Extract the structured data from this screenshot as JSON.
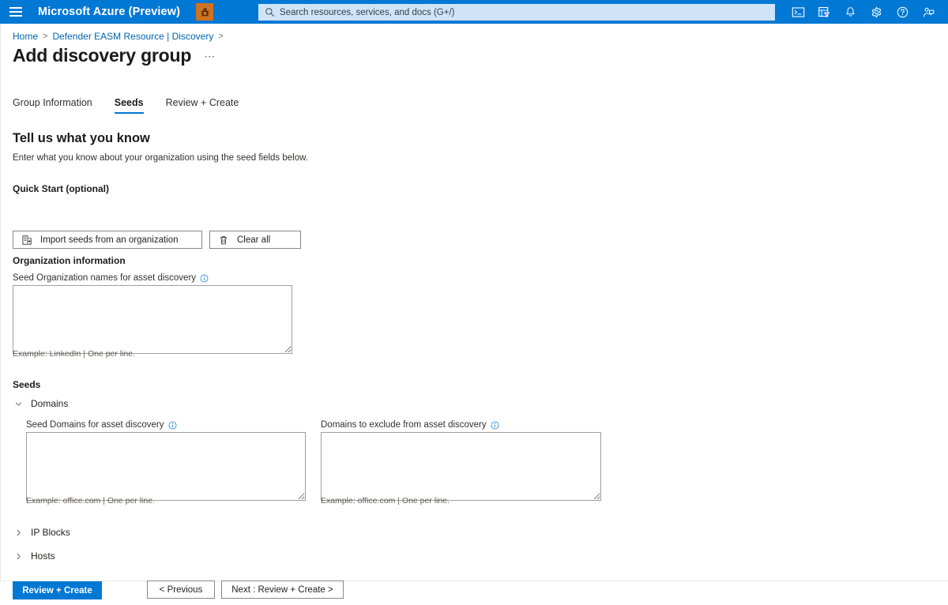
{
  "topbar": {
    "menu_icon": "hamburger-icon",
    "brand": "Microsoft Azure (Preview)",
    "preview_badge_icon": "preview-bug-icon",
    "search": {
      "icon": "search-icon",
      "placeholder": "Search resources, services, and docs (G+/)",
      "value": ""
    },
    "icons": [
      {
        "name": "cloud-shell-icon",
        "title": "Cloud Shell"
      },
      {
        "name": "directory-filter-icon",
        "title": "Directories + subscriptions"
      },
      {
        "name": "notifications-bell-icon",
        "title": "Notifications"
      },
      {
        "name": "settings-gear-icon",
        "title": "Settings"
      },
      {
        "name": "help-question-icon",
        "title": "Help"
      },
      {
        "name": "feedback-icon",
        "title": "Feedback"
      }
    ]
  },
  "breadcrumb": {
    "items": [
      "Home",
      "Defender EASM Resource | Discovery"
    ],
    "separator": ">",
    "trailing_separator": ">"
  },
  "header": {
    "title": "Add discovery group",
    "more_label": "⋯"
  },
  "tabs": [
    {
      "label": "Group Information",
      "active": false
    },
    {
      "label": "Seeds",
      "active": true
    },
    {
      "label": "Review + Create",
      "active": false
    }
  ],
  "main": {
    "section_title": "Tell us what you know",
    "section_subtitle": "Enter what you know about your organization using the seed fields below.",
    "quick_start": {
      "heading": "Quick Start (optional)",
      "import_button": {
        "label": "Import seeds from an organization",
        "icon": "import-organization-icon"
      },
      "clear_button": {
        "label": "Clear all",
        "icon": "trash-icon"
      }
    },
    "organization": {
      "heading": "Organization information",
      "field": {
        "label": "Seed Organization names for asset discovery",
        "info_icon": "info-circle-icon",
        "value": "",
        "helper": "Example: LinkedIn | One per line."
      }
    },
    "seeds": {
      "heading": "Seeds",
      "groups": [
        {
          "label": "Domains",
          "expanded": true,
          "chevron": "chevron-down-icon",
          "fields": [
            {
              "label": "Seed Domains for asset discovery",
              "info_icon": "info-circle-icon",
              "value": "",
              "helper": "Example: office.com | One per line."
            },
            {
              "label": "Domains to exclude from asset discovery",
              "info_icon": "info-circle-icon",
              "value": "",
              "helper": "Example: office.com | One per line."
            }
          ]
        },
        {
          "label": "IP Blocks",
          "expanded": false,
          "chevron": "chevron-right-icon",
          "fields": []
        },
        {
          "label": "Hosts",
          "expanded": false,
          "chevron": "chevron-right-icon",
          "fields": []
        }
      ]
    }
  },
  "footer": {
    "review_create": "Review + Create",
    "previous": "< Previous",
    "next": "Next : Review + Create >"
  },
  "colors": {
    "azure_blue": "#0078d4",
    "link_blue": "#0063b1",
    "preview_orange": "#cf7322",
    "search_bg": "#cfe4f7",
    "border_gray": "#8a8886"
  }
}
